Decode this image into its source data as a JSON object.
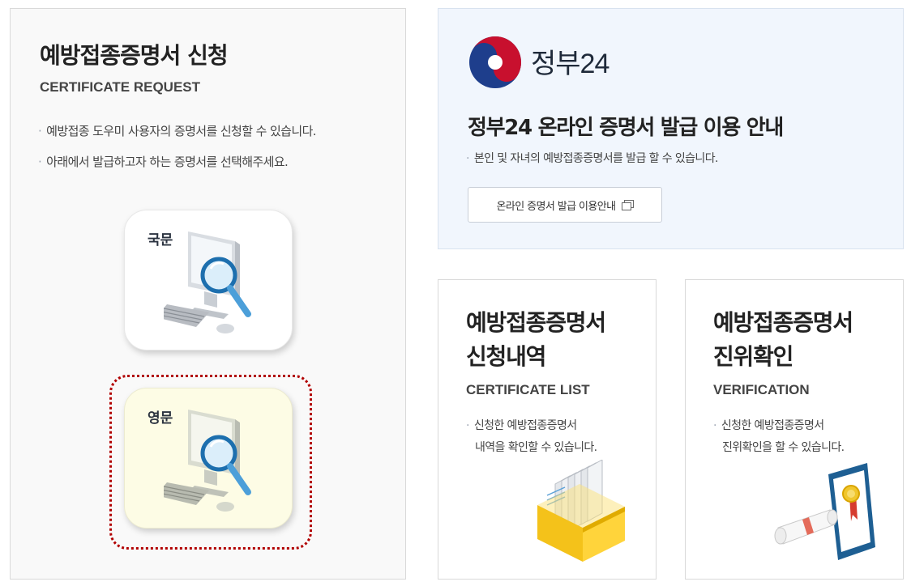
{
  "left": {
    "title": "예방접종증명서 신청",
    "subtitle": "CERTIFICATE REQUEST",
    "bullets": [
      "예방접종 도우미 사용자의 증명서를 신청할 수 있습니다.",
      "아래에서 발급하고자 하는 증명서를 선택해주세요."
    ],
    "options": [
      {
        "label": "국문",
        "icon": "computer-magnifier-icon"
      },
      {
        "label": "영문",
        "icon": "computer-magnifier-icon",
        "selected": true
      }
    ]
  },
  "gov24": {
    "logo_text": "정부24",
    "title": "정부24 온라인 증명서 발급 이용 안내",
    "bullet": "본인 및 자녀의 예방접종증명서를 발급 할 수 있습니다.",
    "button_label": "온라인 증명서 발급 이용안내"
  },
  "cards": [
    {
      "title_line1": "예방접종증명서",
      "title_line2": "신청내역",
      "subtitle": "CERTIFICATE LIST",
      "desc_line1": "신청한 예방접종증명서",
      "desc_line2": "내역을 확인할 수 있습니다.",
      "icon": "document-box-icon"
    },
    {
      "title_line1": "예방접종증명서",
      "title_line2": "진위확인",
      "subtitle": "VERIFICATION",
      "desc_line1": "신청한 예방접종증명서",
      "desc_line2": "진위확인을 할 수 있습니다.",
      "icon": "certificate-scroll-icon"
    }
  ],
  "colors": {
    "selection_outline": "#b10000",
    "selected_bg": "#fdfce5",
    "gov_panel_bg": "#f1f6fd",
    "taeguk_red": "#c8102e",
    "taeguk_blue": "#1e3e8c"
  }
}
